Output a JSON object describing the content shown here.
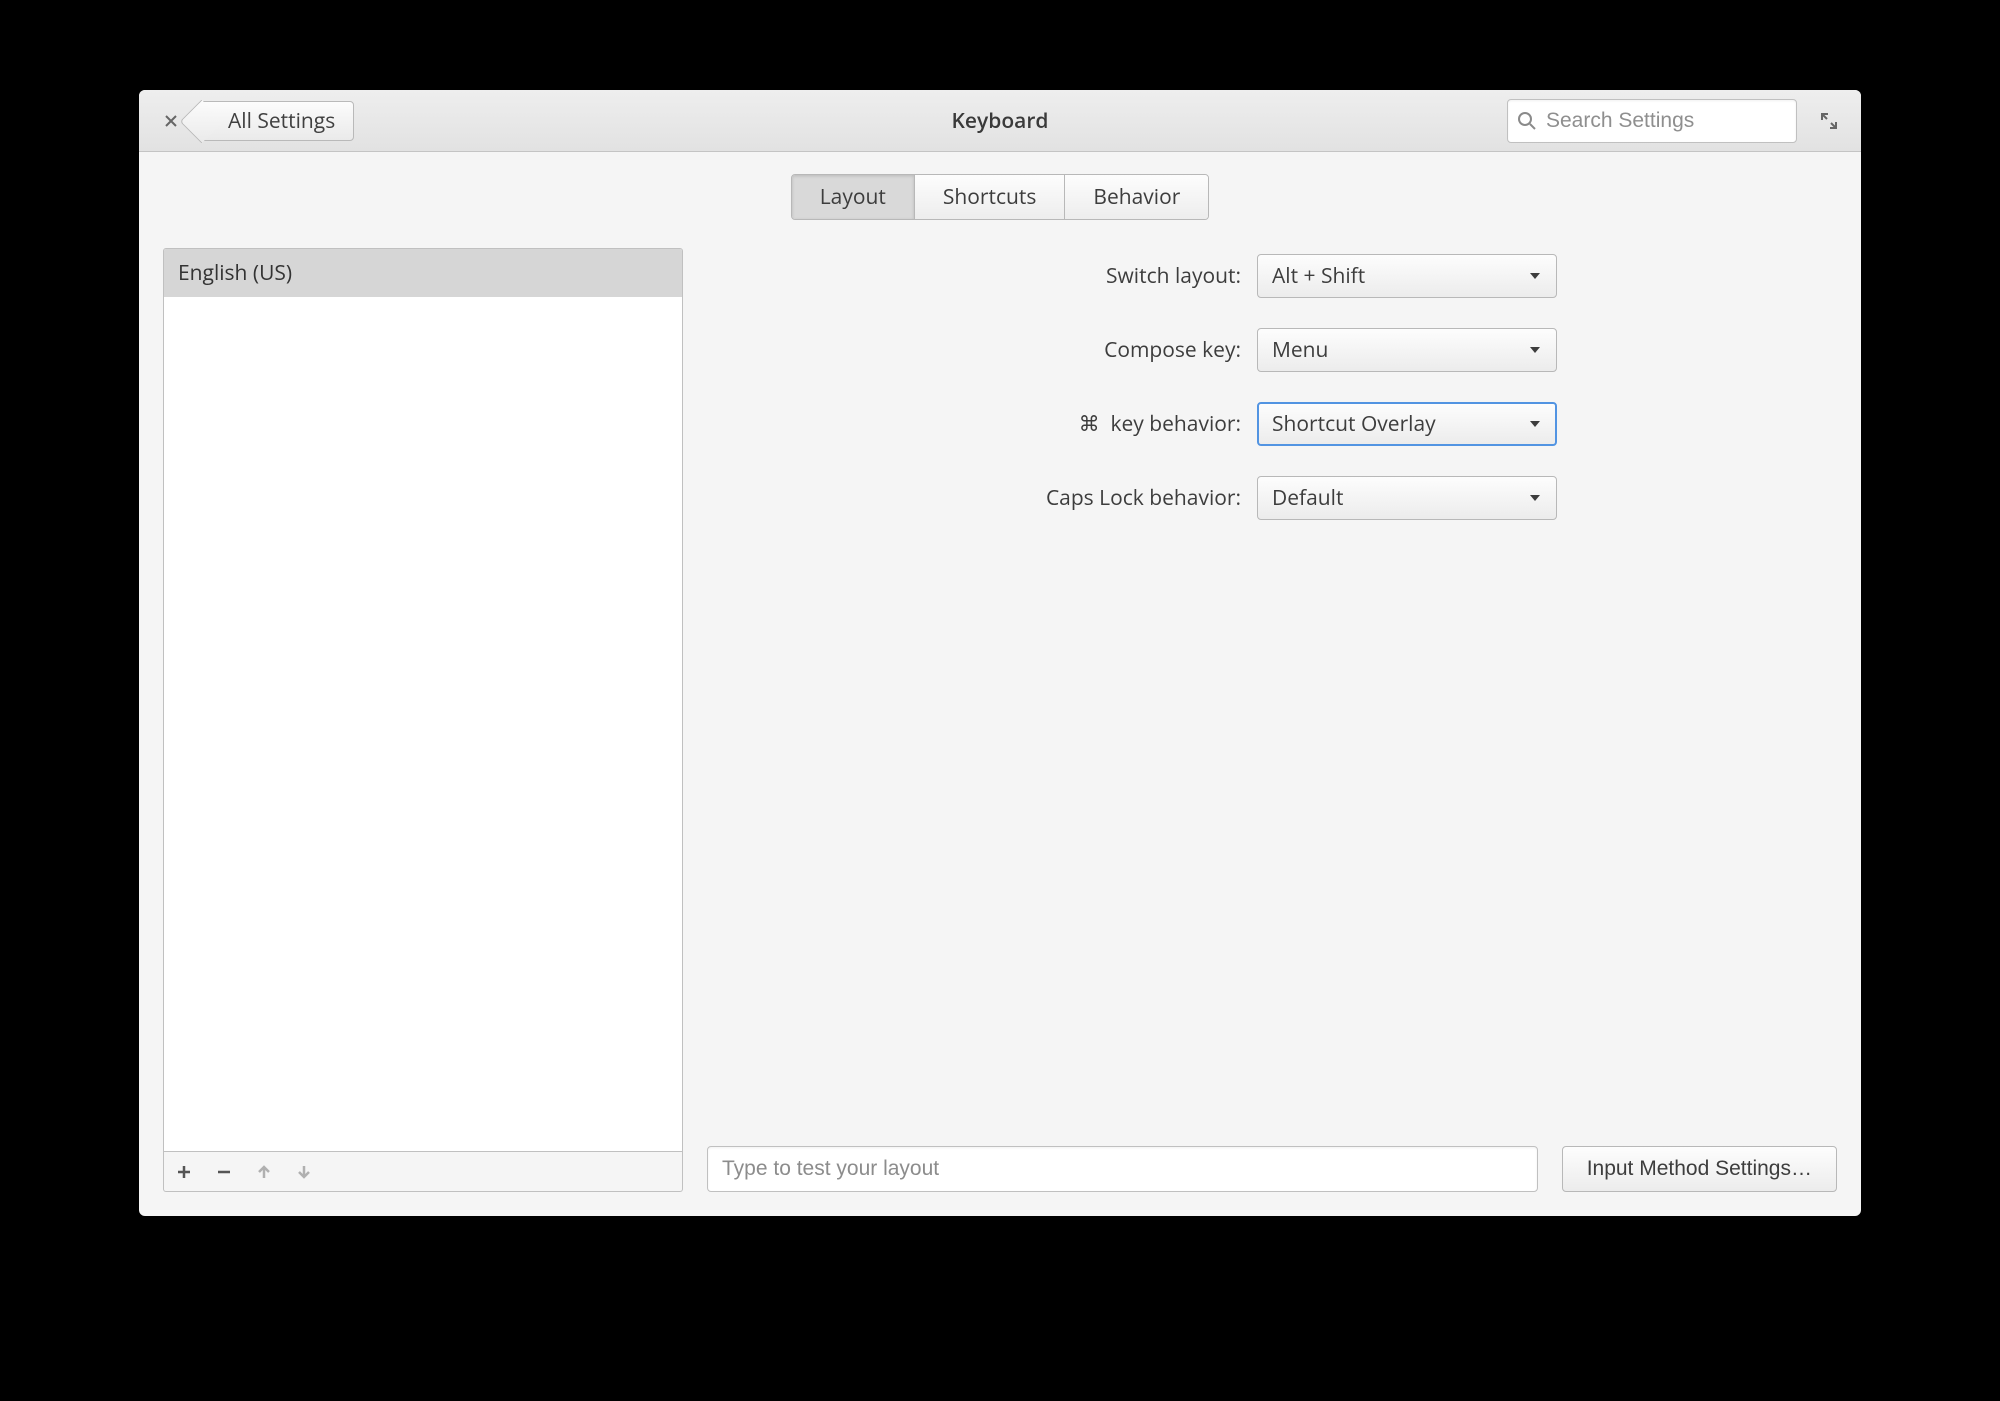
{
  "header": {
    "back_label": "All Settings",
    "title": "Keyboard",
    "search_placeholder": "Search Settings"
  },
  "tabs": {
    "layout": "Layout",
    "shortcuts": "Shortcuts",
    "behavior": "Behavior",
    "active": "Layout"
  },
  "layouts": {
    "items": [
      "English (US)"
    ]
  },
  "settings": {
    "switch_layout": {
      "label": "Switch layout:",
      "value": "Alt + Shift"
    },
    "compose_key": {
      "label": "Compose key:",
      "value": "Menu"
    },
    "cmd_behavior": {
      "label": "key behavior:",
      "icon": "⌘",
      "value": "Shortcut Overlay"
    },
    "caps_lock": {
      "label": "Caps Lock behavior:",
      "value": "Default"
    }
  },
  "bottom": {
    "test_placeholder": "Type to test your layout",
    "ime_button": "Input Method Settings…"
  }
}
